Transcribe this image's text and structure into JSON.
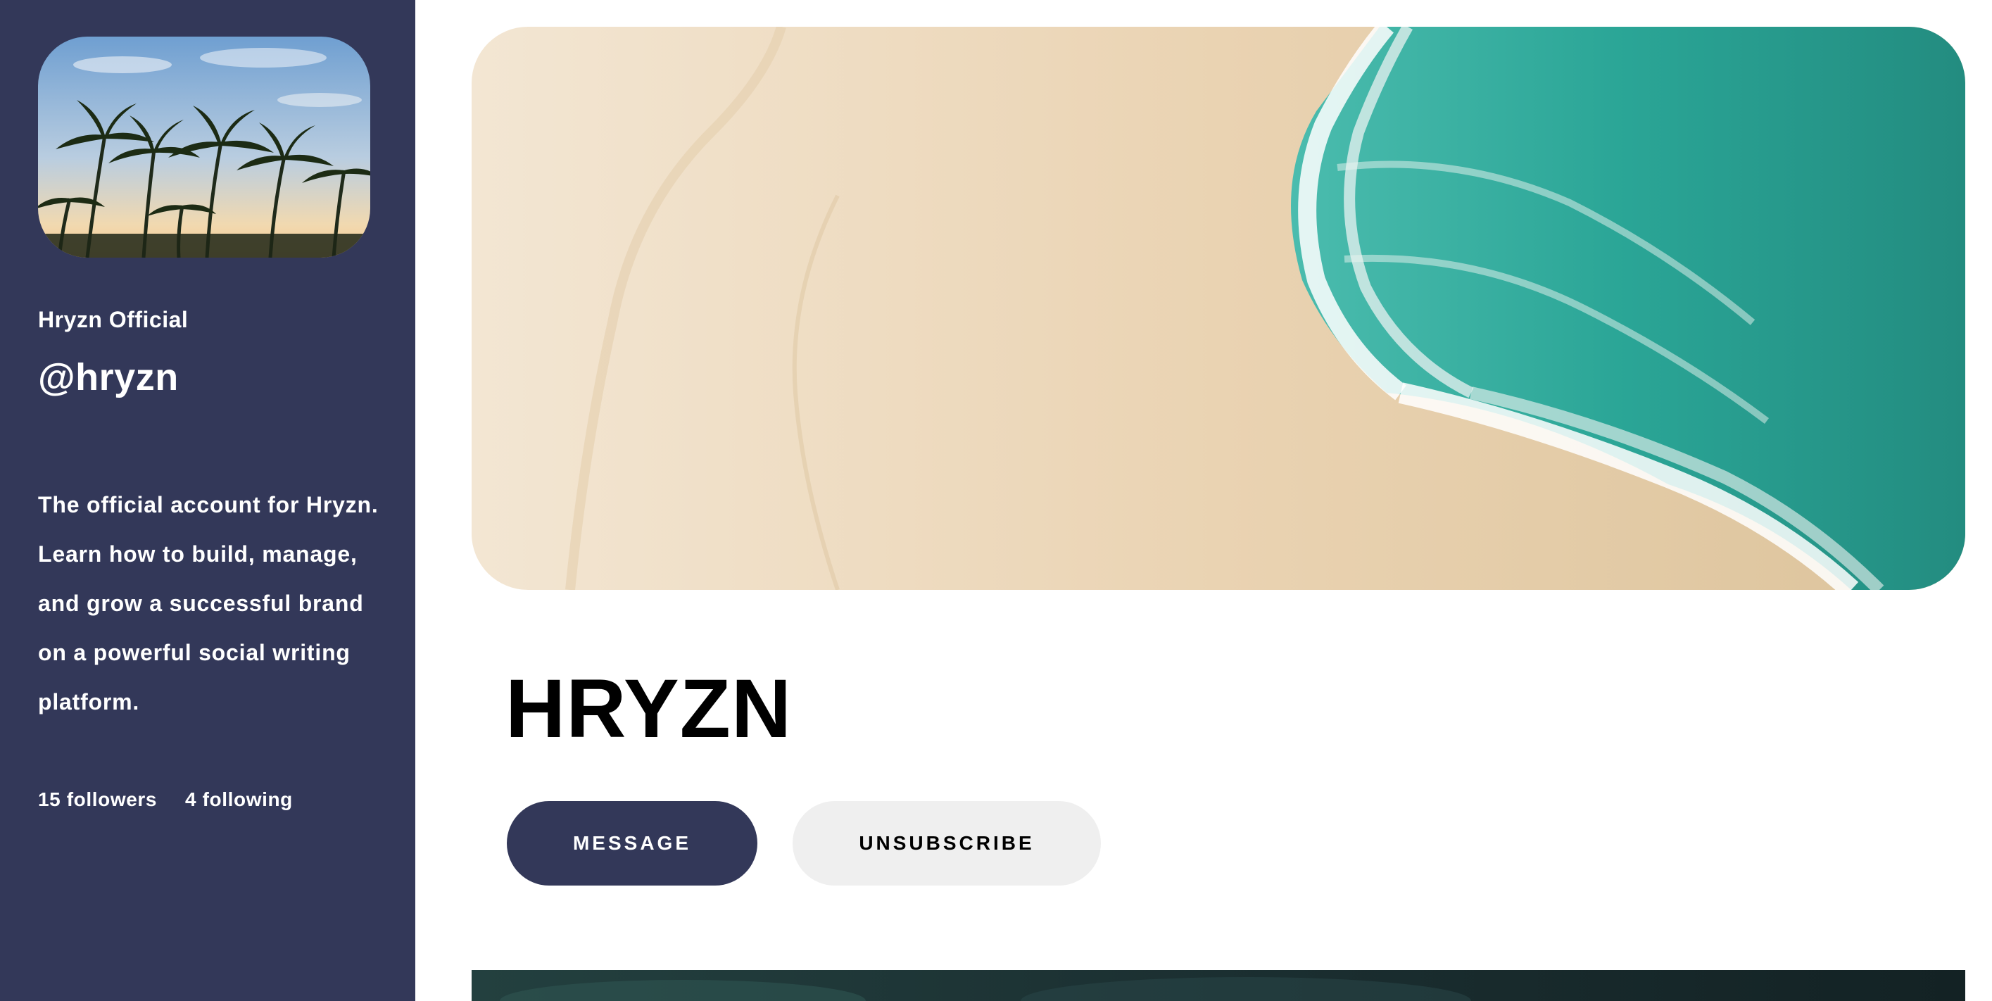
{
  "profile": {
    "display_name": "Hryzn Official",
    "handle": "@hryzn",
    "bio": "The official account for Hryzn. Learn how to build, manage, and grow a successful brand on a powerful social writing platform.",
    "followers_label": "15 followers",
    "following_label": "4 following",
    "avatar": "palm-trees-photo"
  },
  "cover": {
    "image": "aerial-beach-waves-photo"
  },
  "main": {
    "title": "HRYZN",
    "message_button": "MESSAGE",
    "unsubscribe_button": "UNSUBSCRIBE"
  },
  "colors": {
    "sidebar": "#333859",
    "primary_button": "#333859",
    "secondary_button": "#efefef"
  }
}
